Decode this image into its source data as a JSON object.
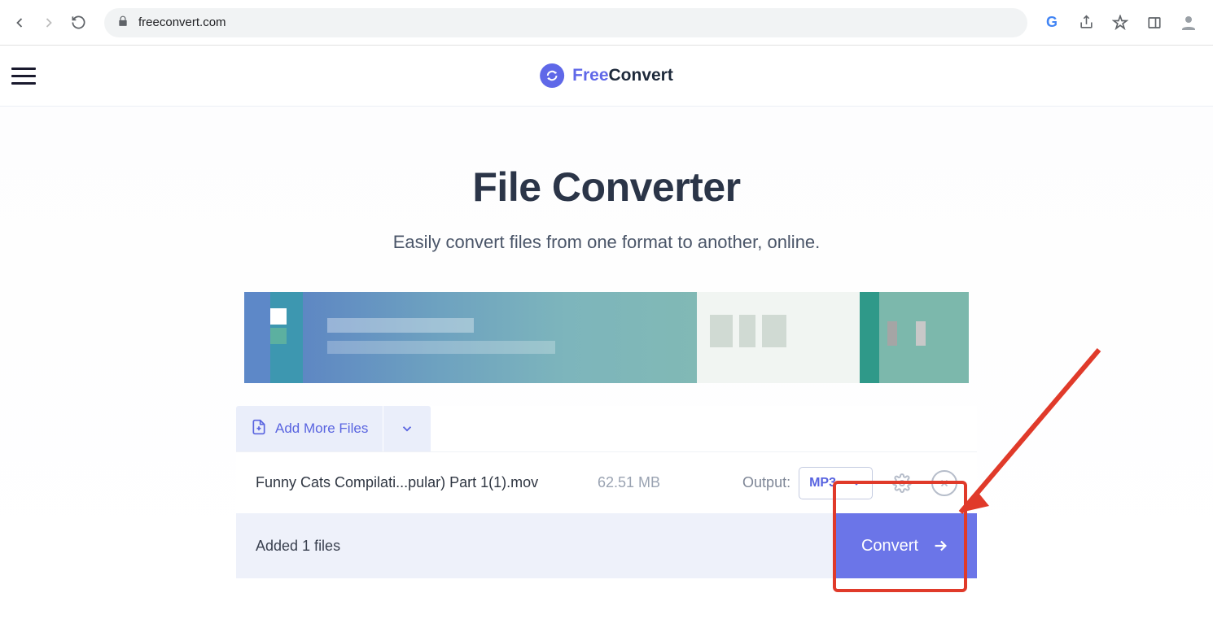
{
  "browser": {
    "url": "freeconvert.com"
  },
  "header": {
    "logo_free": "Free",
    "logo_convert": "Convert"
  },
  "hero": {
    "title": "File Converter",
    "subtitle": "Easily convert files from one format to another, online."
  },
  "panel": {
    "add_more_label": "Add More Files",
    "file": {
      "name": "Funny Cats Compilati...pular) Part 1(1).mov",
      "size": "62.51 MB",
      "output_label": "Output:",
      "output_format": "MP3"
    },
    "footer_label": "Added 1 files",
    "convert_label": "Convert"
  }
}
